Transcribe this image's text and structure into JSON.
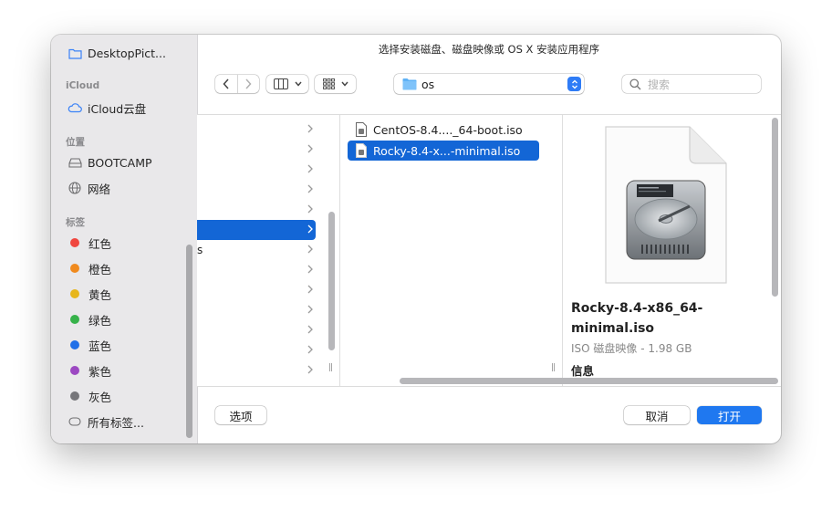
{
  "window": {
    "title": "选择安装磁盘、磁盘映像或 OS X 安装应用程序"
  },
  "sidebar": {
    "favorites": [
      {
        "label": "DesktopPict...",
        "icon": "folder-icon"
      }
    ],
    "icloud_heading": "iCloud",
    "icloud": [
      {
        "label": "iCloud云盘",
        "icon": "cloud-icon"
      }
    ],
    "locations_heading": "位置",
    "locations": [
      {
        "label": "BOOTCAMP",
        "icon": "drive-icon"
      },
      {
        "label": "网络",
        "icon": "globe-icon"
      }
    ],
    "tags_heading": "标签",
    "tags": [
      {
        "label": "红色",
        "color": "#f0463f"
      },
      {
        "label": "橙色",
        "color": "#f08a1e"
      },
      {
        "label": "黄色",
        "color": "#e7b61c"
      },
      {
        "label": "绿色",
        "color": "#36b24a"
      },
      {
        "label": "蓝色",
        "color": "#1f6fe8"
      },
      {
        "label": "紫色",
        "color": "#9c48c2"
      },
      {
        "label": "灰色",
        "color": "#76767a"
      }
    ],
    "all_tags_label": "所有标签..."
  },
  "toolbar": {
    "path_label": "os",
    "search_placeholder": "搜索"
  },
  "browser": {
    "col1_partial_text": "s",
    "files": [
      {
        "name": "CentOS-8.4...._64-boot.iso",
        "selected": false
      },
      {
        "name": "Rocky-8.4-x...-minimal.iso",
        "selected": true
      }
    ],
    "preview": {
      "name": "Rocky-8.4-x86_64-minimal.iso",
      "kind": "ISO 磁盘映像 - 1.98 GB",
      "info_heading": "信息"
    }
  },
  "footer": {
    "options_label": "选项",
    "cancel_label": "取消",
    "open_label": "打开"
  },
  "colors": {
    "accent": "#1366d6",
    "primary_button": "#1f78f0"
  }
}
